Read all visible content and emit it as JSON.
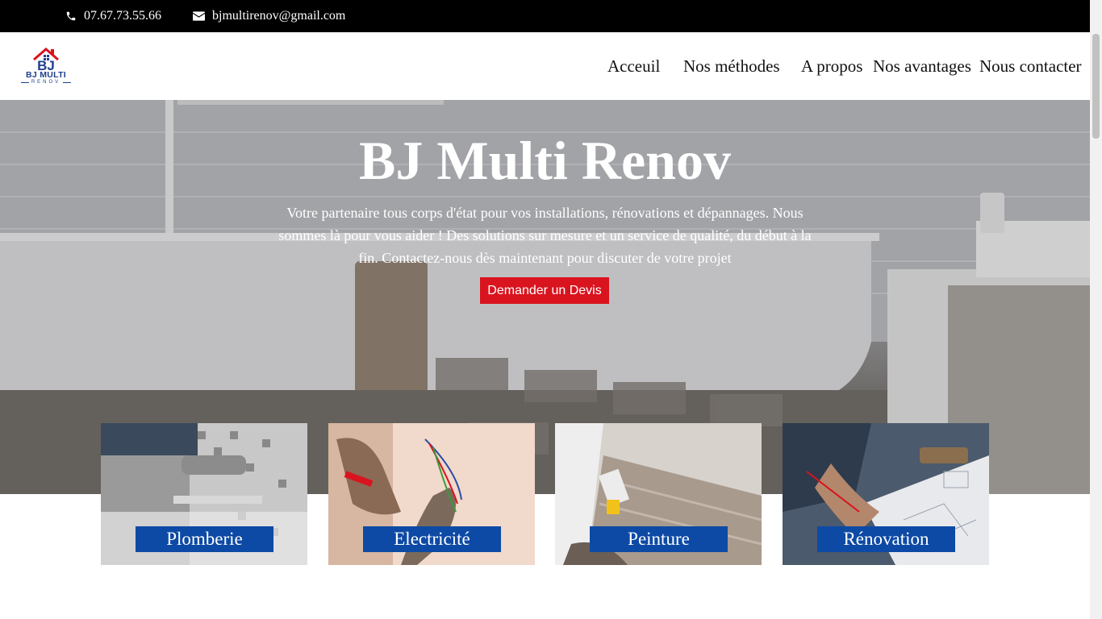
{
  "topbar": {
    "phone": "07.67.73.55.66",
    "email": "bjmultirenov@gmail.com",
    "phone_icon": "phone-icon",
    "email_icon": "envelope-icon"
  },
  "logo": {
    "monogram": "BJ",
    "brand": "BJ MULTI",
    "sub": "RENOV"
  },
  "nav": {
    "items": [
      {
        "label": "Acceuil"
      },
      {
        "label": "Nos méthodes"
      },
      {
        "label": "A propos"
      },
      {
        "label": "Nos avantages"
      },
      {
        "label": "Nous contacter"
      }
    ]
  },
  "hero": {
    "title": "BJ Multi Renov",
    "text": "Votre partenaire tous corps d'état pour vos installations, rénovations et dépannages. Nous sommes là pour vous aider ! Des solutions sur mesure et un service de qualité, du début à la fin. Contactez-nous dès maintenant pour discuter de votre projet",
    "cta": "Demander un Devis"
  },
  "services": [
    {
      "label": "Plomberie"
    },
    {
      "label": "Electricité"
    },
    {
      "label": "Peinture"
    },
    {
      "label": "Rénovation"
    }
  ],
  "colors": {
    "topbar_bg": "#000000",
    "cta_red": "#d9141f",
    "label_blue": "#0d4aa5",
    "logo_blue": "#1f3f8f",
    "logo_red": "#d9141f"
  }
}
